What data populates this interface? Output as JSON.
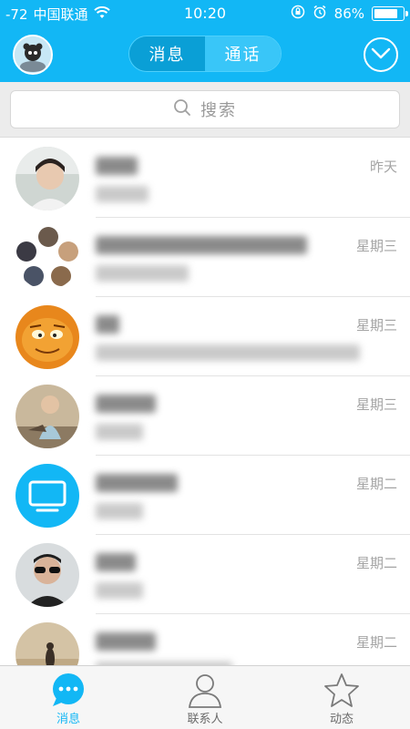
{
  "status_bar": {
    "signal": "-72",
    "carrier": "中国联通",
    "time": "10:20",
    "battery": "86%",
    "battery_level": 0.86
  },
  "header": {
    "tabs": [
      {
        "label": "消息",
        "active": true
      },
      {
        "label": "通话",
        "active": false
      }
    ],
    "menu_icon": "chevron-down-icon"
  },
  "search": {
    "placeholder": "搜索",
    "icon": "search-icon"
  },
  "conversations": [
    {
      "name": "",
      "preview": "",
      "time": "昨天"
    },
    {
      "name": "",
      "preview": "",
      "time": "星期三"
    },
    {
      "name": "",
      "preview": "",
      "time": "星期三"
    },
    {
      "name": "",
      "preview": "",
      "time": "星期三"
    },
    {
      "name": "",
      "preview": "",
      "time": "星期二"
    },
    {
      "name": "",
      "preview": "",
      "time": "星期二"
    },
    {
      "name": "",
      "preview": "",
      "time": "星期二"
    }
  ],
  "tabbar": {
    "items": [
      {
        "label": "消息",
        "icon": "chat-bubble-icon",
        "active": true
      },
      {
        "label": "联系人",
        "icon": "contacts-person-icon",
        "active": false
      },
      {
        "label": "动态",
        "icon": "star-icon",
        "active": false
      }
    ]
  },
  "colors": {
    "brand": "#12b7f5",
    "segment_active": "#0a9fd6",
    "time_text": "#a4a4a4"
  }
}
